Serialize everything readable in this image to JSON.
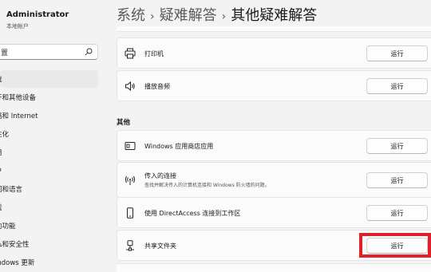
{
  "user": {
    "name": "Administrator",
    "account_type": "本地帐户"
  },
  "search": {
    "value": "置"
  },
  "nav": {
    "items": [
      {
        "label": "统",
        "selected": true
      },
      {
        "label": "牙和其他设备"
      },
      {
        "label": "络和 Internet"
      },
      {
        "label": "性化"
      },
      {
        "label": "用"
      },
      {
        "label": "户"
      },
      {
        "label": "间和语言"
      },
      {
        "label": "戏"
      },
      {
        "label": "助功能"
      },
      {
        "label": "私和安全性"
      },
      {
        "label": "indows 更新"
      }
    ]
  },
  "breadcrumb": {
    "part1": "系统",
    "part2": "疑难解答",
    "current": "其他疑难解答",
    "separator": "›"
  },
  "run_label": "运行",
  "section_other": "其他",
  "cards": {
    "printer": {
      "label": "打印机"
    },
    "audio": {
      "label": "播放音频"
    },
    "store": {
      "label": "Windows 应用商店应用"
    },
    "incoming": {
      "label": "传入的连接",
      "sub": "查找并解决传入的计算机连接和 Windows 防火墙的问题。"
    },
    "directaccess": {
      "label": "使用 DirectAccess 连接到工作区"
    },
    "shared": {
      "label": "共享文件夹"
    }
  },
  "colors": {
    "highlight": "#e0202a"
  }
}
